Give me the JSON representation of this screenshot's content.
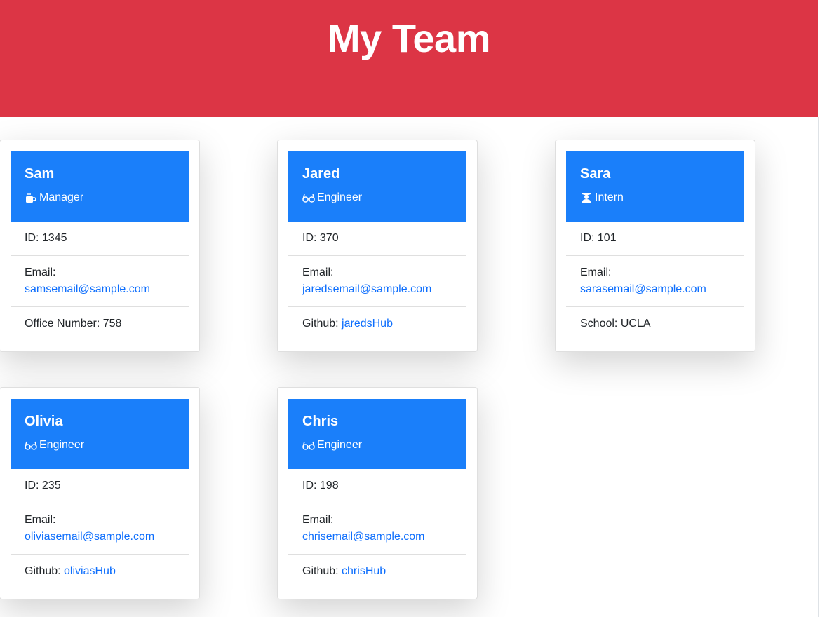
{
  "page": {
    "title": "My Team"
  },
  "colors": {
    "header_bg": "#dc3545",
    "card_header_bg": "#1a7ffa",
    "link": "#0d6efd"
  },
  "team": [
    {
      "name": "Sam",
      "role": "Manager",
      "icon": "coffee-mug-icon",
      "id": "ID: 1345",
      "email_label": "Email:",
      "email": "samsemail@sample.com",
      "extra_label": "Office Number: 758",
      "extra_link": ""
    },
    {
      "name": "Jared",
      "role": "Engineer",
      "icon": "glasses-icon",
      "id": "ID: 370",
      "email_label": "Email:",
      "email": "jaredsemail@sample.com",
      "extra_label": "Github: ",
      "extra_link": "jaredsHub"
    },
    {
      "name": "Sara",
      "role": "Intern",
      "icon": "graduate-icon",
      "id": "ID: 101",
      "email_label": "Email:",
      "email": "sarasemail@sample.com",
      "extra_label": "School: UCLA",
      "extra_link": ""
    },
    {
      "name": "Olivia",
      "role": "Engineer",
      "icon": "glasses-icon",
      "id": "ID: 235",
      "email_label": "Email:",
      "email": "oliviasemail@sample.com",
      "extra_label": "Github: ",
      "extra_link": "oliviasHub"
    },
    {
      "name": "Chris",
      "role": "Engineer",
      "icon": "glasses-icon",
      "id": "ID: 198",
      "email_label": "Email:",
      "email": "chrisemail@sample.com",
      "extra_label": "Github: ",
      "extra_link": "chrisHub"
    }
  ]
}
